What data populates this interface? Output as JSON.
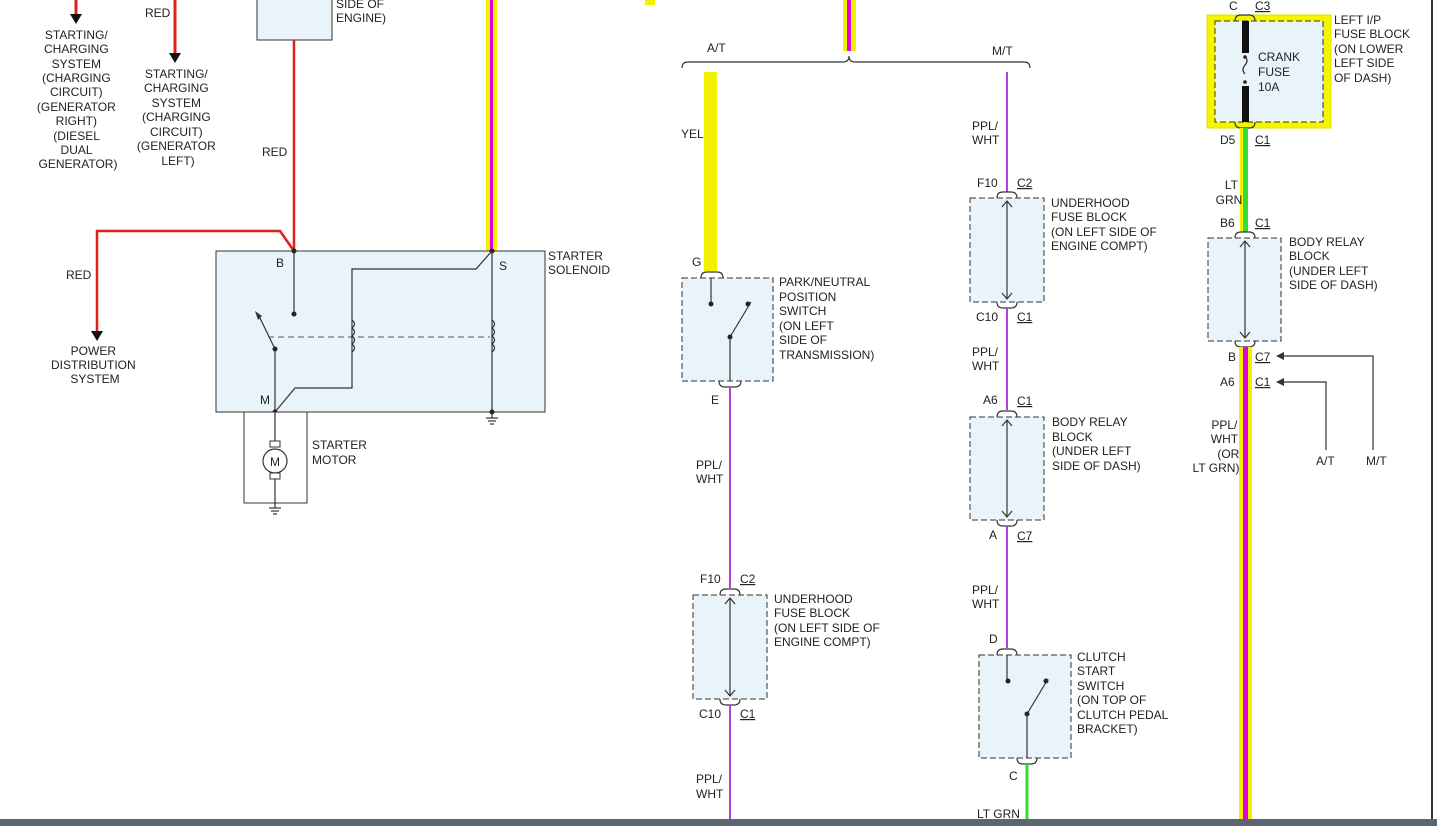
{
  "wire_colors": {
    "red": "#e0201c",
    "yellow": "#f2f200",
    "pink": "#e000e0",
    "violet": "#b040e0",
    "green": "#33dd33",
    "black": "#111111",
    "fuse_highlight": "#f5f500",
    "component_fill": "#e8f4fa"
  },
  "labels": {
    "charging_right": [
      "STARTING/",
      "CHARGING",
      "SYSTEM",
      "(CHARGING",
      "CIRCUIT)",
      "(GENERATOR",
      "RIGHT)",
      "(DIESEL",
      "DUAL",
      "GENERATOR)"
    ],
    "charging_left": [
      "STARTING/",
      "CHARGING",
      "SYSTEM",
      "(CHARGING",
      "CIRCUIT)",
      "(GENERATOR",
      "LEFT)"
    ],
    "red_top": "RED",
    "red_mid": "RED",
    "red_left": "RED",
    "side_of_engine": [
      "SIDE OF",
      "ENGINE)"
    ],
    "power_distribution": [
      "POWER",
      "DISTRIBUTION",
      "SYSTEM"
    ],
    "starter_solenoid": [
      "STARTER",
      "SOLENOID"
    ],
    "terminal_b": "B",
    "terminal_s": "S",
    "terminal_m": "M",
    "starter_motor": [
      "STARTER",
      "MOTOR"
    ],
    "motor_symbol": "M",
    "at_top": "A/T",
    "mt_top": "M/T",
    "yel": "YEL",
    "pnp_g": "G",
    "pnp_switch": [
      "PARK/NEUTRAL",
      "POSITION",
      "SWITCH",
      "(ON LEFT",
      "SIDE OF",
      "TRANSMISSION)"
    ],
    "pnp_e": "E",
    "ppl_wht": [
      "PPL/",
      "WHT"
    ],
    "ufb_left_f10": "F10",
    "ufb_left_c2": "C2",
    "ufb_left": [
      "UNDERHOOD",
      "FUSE BLOCK",
      "(ON LEFT SIDE OF",
      "ENGINE COMPT)"
    ],
    "ufb_left_c10": "C10",
    "ufb_left_c1": "C1",
    "ufb_mid_f10": "F10",
    "ufb_mid_c2": "C2",
    "ufb_mid": [
      "UNDERHOOD",
      "FUSE BLOCK",
      "(ON LEFT SIDE OF",
      "ENGINE COMPT)"
    ],
    "ufb_mid_c10": "C10",
    "ufb_mid_c1": "C1",
    "brb_mid_a6": "A6",
    "brb_mid_c1": "C1",
    "brb_mid": [
      "BODY RELAY",
      "BLOCK",
      "(UNDER LEFT",
      "SIDE OF DASH)"
    ],
    "brb_mid_a": "A",
    "brb_mid_c7": "C7",
    "clutch_d": "D",
    "clutch_switch": [
      "CLUTCH",
      "START",
      "SWITCH",
      "(ON TOP OF",
      "CLUTCH PEDAL",
      "BRACKET)"
    ],
    "clutch_c": "C",
    "lt_grn_bottom": "LT GRN",
    "fuse_c": "C",
    "fuse_c3": "C3",
    "crank_fuse": [
      "CRANK",
      "FUSE",
      "10A"
    ],
    "left_ip_fuse_block": [
      "LEFT I/P",
      "FUSE BLOCK",
      "(ON LOWER",
      "LEFT SIDE",
      "OF DASH)"
    ],
    "fuse_d5": "D5",
    "fuse_c1": "C1",
    "lt_grn_right": [
      "LT",
      "GRN"
    ],
    "brb_right_b6": "B6",
    "brb_right_c1": "C1",
    "brb_right": [
      "BODY RELAY",
      "BLOCK",
      "(UNDER LEFT",
      "SIDE OF DASH)"
    ],
    "brb_right_b": "B",
    "brb_right_c7": "C7",
    "brb_right_a6": "A6",
    "brb_right_c1b": "C1",
    "ppl_wht_or_ltgrn": [
      "PPL/",
      "WHT",
      "(OR",
      "LT GRN)"
    ],
    "at_right": "A/T",
    "mt_right": "M/T"
  }
}
